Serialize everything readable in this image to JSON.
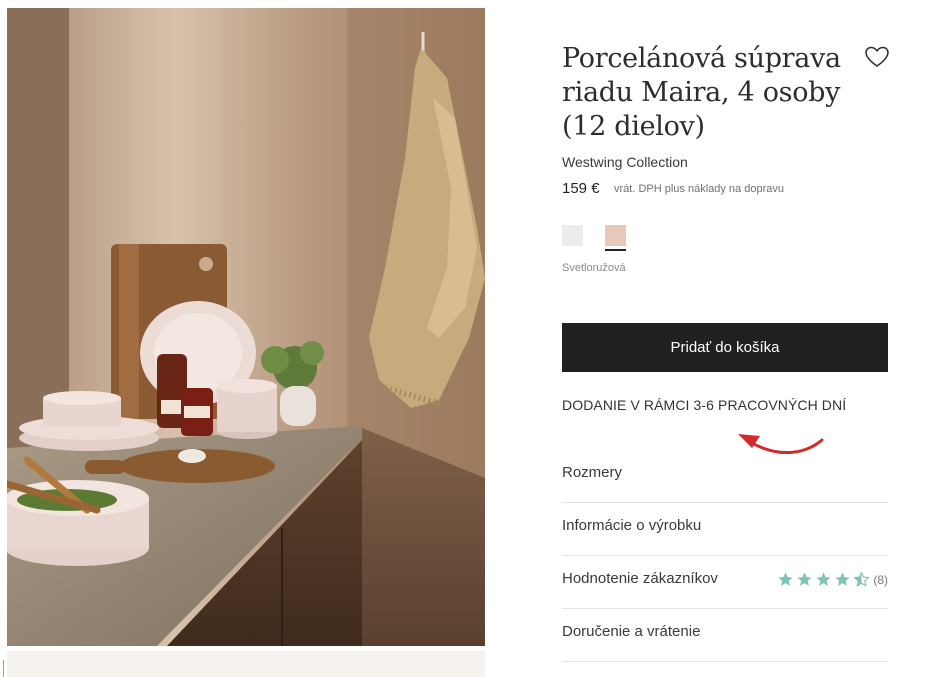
{
  "product": {
    "title": "Porcelánová súprava riadu Maira, 4 osoby (12 dielov)",
    "brand": "Westwing Collection",
    "price": "159 €",
    "vat_note": "vrát. DPH plus náklady na dopravu",
    "color_options": [
      {
        "name": "light-gray",
        "hex": "#ececec"
      },
      {
        "name": "Svetloružová",
        "hex": "#e6c9b8",
        "selected": true
      }
    ],
    "selected_color": "Svetloružová"
  },
  "actions": {
    "add_to_cart": "Pridať do košíka"
  },
  "delivery": {
    "text": "DODANIE V RÁMCI 3-6 PRACOVNÝCH DNÍ"
  },
  "accordion": [
    {
      "label": "Rozmery"
    },
    {
      "label": "Informácie o výrobku"
    },
    {
      "label": "Hodnotenie zákazníkov",
      "rating": 4.5,
      "review_count": "(8)"
    },
    {
      "label": "Doručenie a vrátenie"
    }
  ],
  "colors": {
    "button_bg": "#212121",
    "star": "#7fc4b4",
    "annotation_arrow": "#d42a2a"
  },
  "icons": [
    "heart-icon",
    "star-icon",
    "half-star-icon",
    "arrow-annotation-icon"
  ]
}
